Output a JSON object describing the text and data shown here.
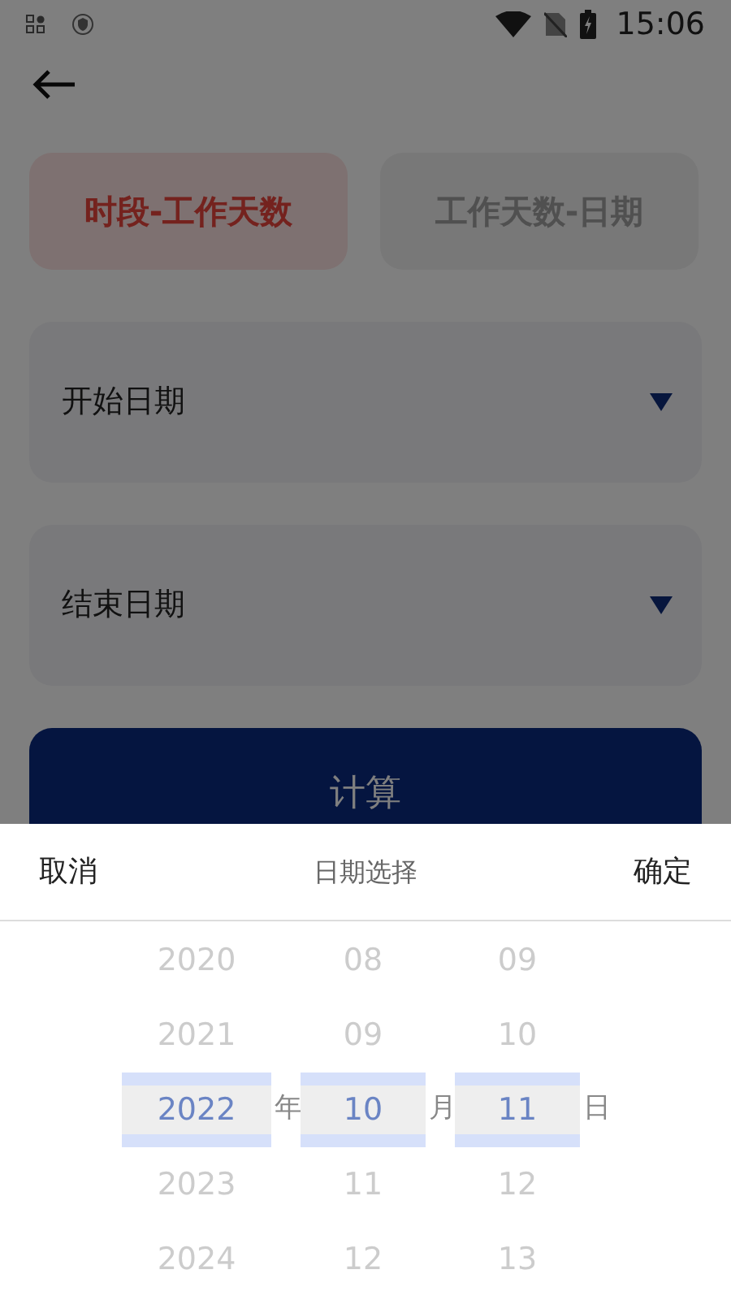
{
  "status_bar": {
    "time": "15:06"
  },
  "tabs": [
    {
      "label": "时段-工作天数",
      "selected": true
    },
    {
      "label": "工作天数-日期",
      "selected": false
    }
  ],
  "fields": [
    {
      "placeholder": "开始日期"
    },
    {
      "placeholder": "结束日期"
    }
  ],
  "calculate_button": "计算",
  "picker": {
    "cancel": "取消",
    "title": "日期选择",
    "confirm": "确定",
    "columns": [
      {
        "unit": "年",
        "items": [
          {
            "label": "2020",
            "selected": false
          },
          {
            "label": "2021",
            "selected": false
          },
          {
            "label": "2022",
            "selected": true
          },
          {
            "label": "2023",
            "selected": false
          },
          {
            "label": "2024",
            "selected": false
          }
        ]
      },
      {
        "unit": "月",
        "items": [
          {
            "label": "08",
            "selected": false
          },
          {
            "label": "09",
            "selected": false
          },
          {
            "label": "10",
            "selected": true
          },
          {
            "label": "11",
            "selected": false
          },
          {
            "label": "12",
            "selected": false
          }
        ]
      },
      {
        "unit": "日",
        "items": [
          {
            "label": "09",
            "selected": false
          },
          {
            "label": "10",
            "selected": false
          },
          {
            "label": "11",
            "selected": true
          },
          {
            "label": "12",
            "selected": false
          },
          {
            "label": "13",
            "selected": false
          }
        ]
      }
    ]
  }
}
